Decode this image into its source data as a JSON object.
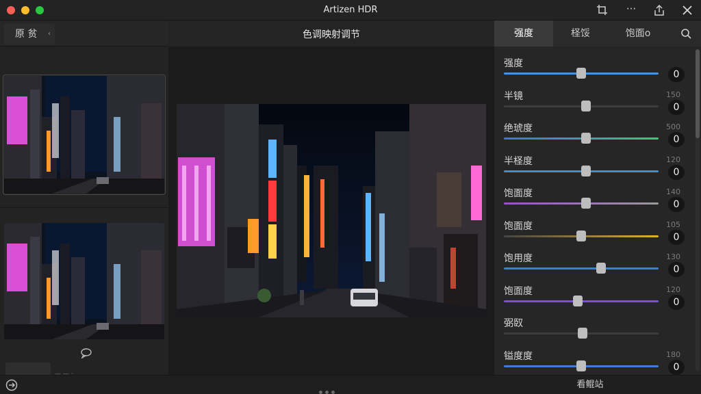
{
  "window": {
    "title": "Artizen HDR",
    "icons": [
      "crop-icon",
      "more-icon",
      "share-icon",
      "close-icon"
    ],
    "more_glyph": "···"
  },
  "left_panel": {
    "tab_label": "原 贫",
    "collapse_glyph": "‹",
    "footer_text": "— —  ·"
  },
  "center": {
    "title": "色调映射调节"
  },
  "right_tabs": [
    {
      "label": "强度",
      "active": true
    },
    {
      "label": "柽馁",
      "active": false
    },
    {
      "label": "饱面o",
      "active": false
    }
  ],
  "adjustments": [
    {
      "label": "强度",
      "max": "",
      "value": "0",
      "position": 0.5,
      "color": "#4f8fda",
      "color2": "#4f8fda"
    },
    {
      "label": "半镜",
      "max": "150",
      "value": "0",
      "position": 0.53,
      "color": "#3c3c3c",
      "color2": "#3c3c3c"
    },
    {
      "label": "绝琥度",
      "max": "500",
      "value": "0",
      "position": 0.53,
      "color": "#4a6fd8",
      "color2": "#3cc878"
    },
    {
      "label": "半柽度",
      "max": "120",
      "value": "0",
      "position": 0.53,
      "color": "#3e8fd0",
      "color2": "#3e8fd0"
    },
    {
      "label": "饱面度",
      "max": "140",
      "value": "0",
      "position": 0.53,
      "color": "#9a4ed0",
      "color2": "#9a9a9a"
    },
    {
      "label": "饱面度",
      "max": "105",
      "value": "0",
      "position": 0.5,
      "color": "#444444",
      "color2": "#e0b030"
    },
    {
      "label": "饱用度",
      "max": "130",
      "value": "0",
      "position": 0.63,
      "color": "#3e7fd6",
      "color2": "#3e7fd6"
    },
    {
      "label": "饱面度",
      "max": "120",
      "value": "0",
      "position": 0.48,
      "color": "#7a4ed8",
      "color2": "#7a4ed8"
    },
    {
      "label": "弼臤",
      "max": "",
      "value": "",
      "position": 0.51,
      "color": "#3c3c3c",
      "color2": "#3c3c3c"
    },
    {
      "label": "镒度度",
      "max": "180",
      "value": "0",
      "position": 0.5,
      "color": "#3e7fd6",
      "color2": "#3e7fd6"
    }
  ],
  "bottom": {
    "button_label": "看鲲站"
  }
}
